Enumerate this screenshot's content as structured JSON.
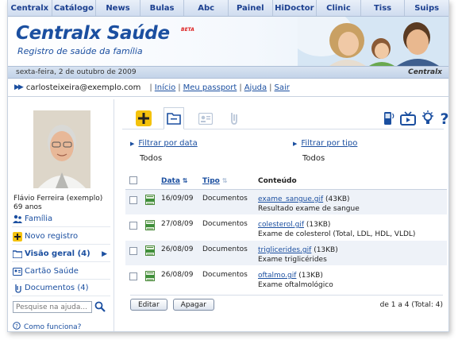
{
  "nav": [
    "Centralx",
    "Catálogo",
    "News",
    "Bulas",
    "Abc",
    "Painel",
    "HiDoctor",
    "Clinic",
    "Tiss",
    "Suips"
  ],
  "header": {
    "brand": "Centralx Saúde",
    "beta": "BETA",
    "tagline": "Registro de saúde da família"
  },
  "datebar": {
    "date": "sexta-feira, 2 de outubro de 2009",
    "brand": "Centralx"
  },
  "user": {
    "email": "carlosteixeira@exemplo.com",
    "links": [
      "Início",
      "Meu passport",
      "Ajuda",
      "Sair"
    ]
  },
  "sidebar": {
    "name": "Flávio Ferreira (exemplo)",
    "age": "69 anos",
    "items": [
      {
        "label": "Família",
        "icon": "family-icon"
      },
      {
        "label": "Novo registro",
        "icon": "plus-icon"
      },
      {
        "label": "Visão geral (4)",
        "icon": "folder-icon"
      },
      {
        "label": "Cartão Saúde",
        "icon": "card-icon"
      },
      {
        "label": "Documentos (4)",
        "icon": "documents-icon"
      }
    ],
    "search_placeholder": "Pesquise na ajuda...",
    "howto": "Como funciona?"
  },
  "filters": {
    "date_label": "Filtrar por data",
    "date_value": "Todos",
    "type_label": "Filtrar por tipo",
    "type_value": "Todos"
  },
  "table": {
    "headers": {
      "date": "Data",
      "type": "Tipo",
      "content": "Conteúdo"
    },
    "rows": [
      {
        "date": "16/09/09",
        "type": "Documentos",
        "file": "exame_sangue.gif",
        "size": "(43KB)",
        "desc": "Resultado exame de sangue"
      },
      {
        "date": "27/08/09",
        "type": "Documentos",
        "file": "colesterol.gif",
        "size": "(13KB)",
        "desc": "Exame de colesterol (Total, LDL, HDL, VLDL)"
      },
      {
        "date": "26/08/09",
        "type": "Documentos",
        "file": "triglicerides.gif",
        "size": "(13KB)",
        "desc": "Exame triglicérides"
      },
      {
        "date": "26/08/09",
        "type": "Documentos",
        "file": "oftalmo.gif",
        "size": "(13KB)",
        "desc": "Exame oftalmológico"
      }
    ]
  },
  "footer": {
    "edit": "Editar",
    "delete": "Apagar",
    "pager": "de 1 a 4 (Total: 4)"
  },
  "colors": {
    "accent": "#1b4fa0",
    "row_alt": "#eef2f8",
    "yellow": "#f4c20d"
  }
}
